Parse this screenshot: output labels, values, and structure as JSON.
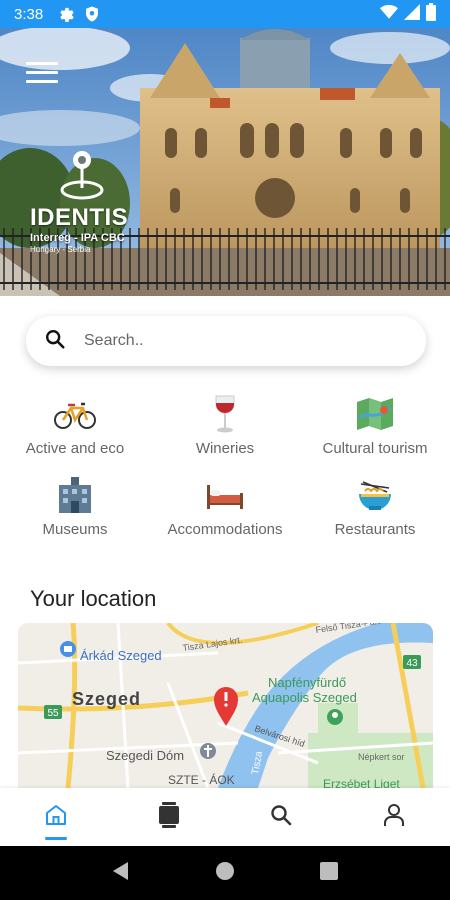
{
  "status_bar": {
    "time": "3:38",
    "icons": [
      "gear-icon",
      "shield-icon",
      "wifi-icon",
      "signal-icon",
      "battery-icon"
    ],
    "background": "#2196f3"
  },
  "hero": {
    "logo_text": "IDENTIS",
    "logo_subtitle": "Interreg - IPA CBC",
    "logo_subtitle2": "Hungary - Serbia",
    "menu_icon": "hamburger-menu-icon"
  },
  "search": {
    "placeholder": "Search.."
  },
  "categories": [
    {
      "label": "Active and eco",
      "icon": "bicycle-icon"
    },
    {
      "label": "Wineries",
      "icon": "wine-glass-icon"
    },
    {
      "label": "Cultural tourism",
      "icon": "map-icon"
    },
    {
      "label": "Museums",
      "icon": "museum-building-icon"
    },
    {
      "label": "Accommodations",
      "icon": "bed-icon"
    },
    {
      "label": "Restaurants",
      "icon": "noodle-bowl-icon"
    }
  ],
  "location": {
    "title": "Your location",
    "map_labels": {
      "arkad": "Árkád Szeged",
      "tisza_lajos": "Tisza Lajos krt.",
      "felso": "Felső Tisza-Part",
      "route43": "43",
      "szeged": "Szeged",
      "napfeny1": "Napfényfürdő",
      "napfeny2": "Aquapolis Szeged",
      "route55": "55",
      "belvarosi": "Belvárosi híd",
      "dom": "Szegedi Dóm",
      "tisza": "Tisza",
      "szte": "SZTE - ÁOK",
      "nepkert": "Népkert sor",
      "erzsebet": "Erzsébet Liget"
    }
  },
  "bottom_nav": [
    {
      "icon": "home-icon",
      "active": true
    },
    {
      "icon": "cards-icon",
      "active": false
    },
    {
      "icon": "search-icon",
      "active": false
    },
    {
      "icon": "person-icon",
      "active": false
    }
  ],
  "accent_color": "#2196f3"
}
